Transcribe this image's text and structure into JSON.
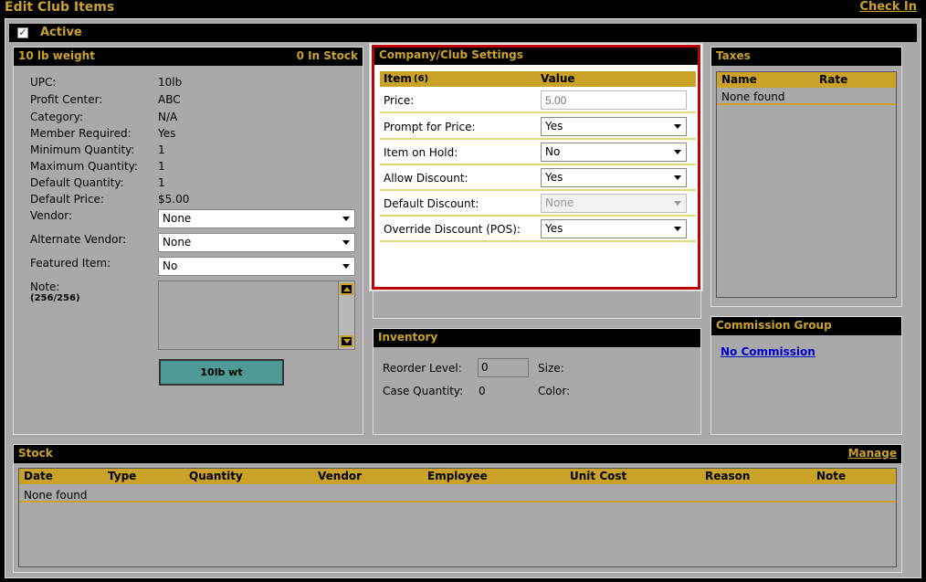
{
  "window": {
    "title": "Edit Club Items",
    "check_in": "Check In"
  },
  "active": {
    "label": "Active",
    "checked": true
  },
  "item_panel": {
    "header": "10 lb weight",
    "stock_status": "0 In Stock",
    "fields": [
      {
        "label": "UPC:",
        "value": "10lb"
      },
      {
        "label": "Profit Center:",
        "value": "ABC"
      },
      {
        "label": "Category:",
        "value": "N/A"
      },
      {
        "label": "Member Required:",
        "value": "Yes"
      },
      {
        "label": "Minimum Quantity:",
        "value": "1"
      },
      {
        "label": "Maximum Quantity:",
        "value": "1"
      },
      {
        "label": "Default Quantity:",
        "value": "1"
      },
      {
        "label": "Default Price:",
        "value": "$5.00"
      }
    ],
    "vendor": {
      "label": "Vendor:",
      "value": "None"
    },
    "alt_vendor": {
      "label": "Alternate Vendor:",
      "value": "None"
    },
    "featured": {
      "label": "Featured Item:",
      "value": "No"
    },
    "note": {
      "label": "Note:",
      "counter": "(256/256)"
    },
    "button": "10lb wt"
  },
  "company_settings": {
    "header": "Company/Club Settings",
    "col_item": "Item",
    "col_count": "(6)",
    "col_value": "Value",
    "price": {
      "label": "Price:",
      "placeholder": "5.00"
    },
    "rows": [
      {
        "label": "Prompt for Price:",
        "value": "Yes"
      },
      {
        "label": "Item on Hold:",
        "value": "No"
      },
      {
        "label": "Allow Discount:",
        "value": "Yes"
      },
      {
        "label": "Default Discount:",
        "value": "None"
      },
      {
        "label": "Override Discount (POS):",
        "value": "Yes"
      }
    ]
  },
  "taxes": {
    "header": "Taxes",
    "col_name": "Name",
    "col_rate": "Rate",
    "empty": "None found"
  },
  "inventory": {
    "header": "Inventory",
    "reorder_label": "Reorder Level:",
    "reorder_value": "0",
    "size_label": "Size:",
    "case_label": "Case Quantity:",
    "case_value": "0",
    "color_label": "Color:"
  },
  "commission": {
    "header": "Commission Group",
    "link": "No Commission"
  },
  "stock": {
    "header": "Stock",
    "manage": "Manage",
    "columns": [
      "Date",
      "Type",
      "Quantity",
      "Vendor",
      "Employee",
      "Unit Cost",
      "Reason",
      "Note"
    ],
    "empty": "None found"
  },
  "colors": {
    "gold": "#c9a227",
    "panel_bg": "#a9a9a9",
    "highlight_red": "#c00000",
    "button_teal": "#4f9a94"
  }
}
